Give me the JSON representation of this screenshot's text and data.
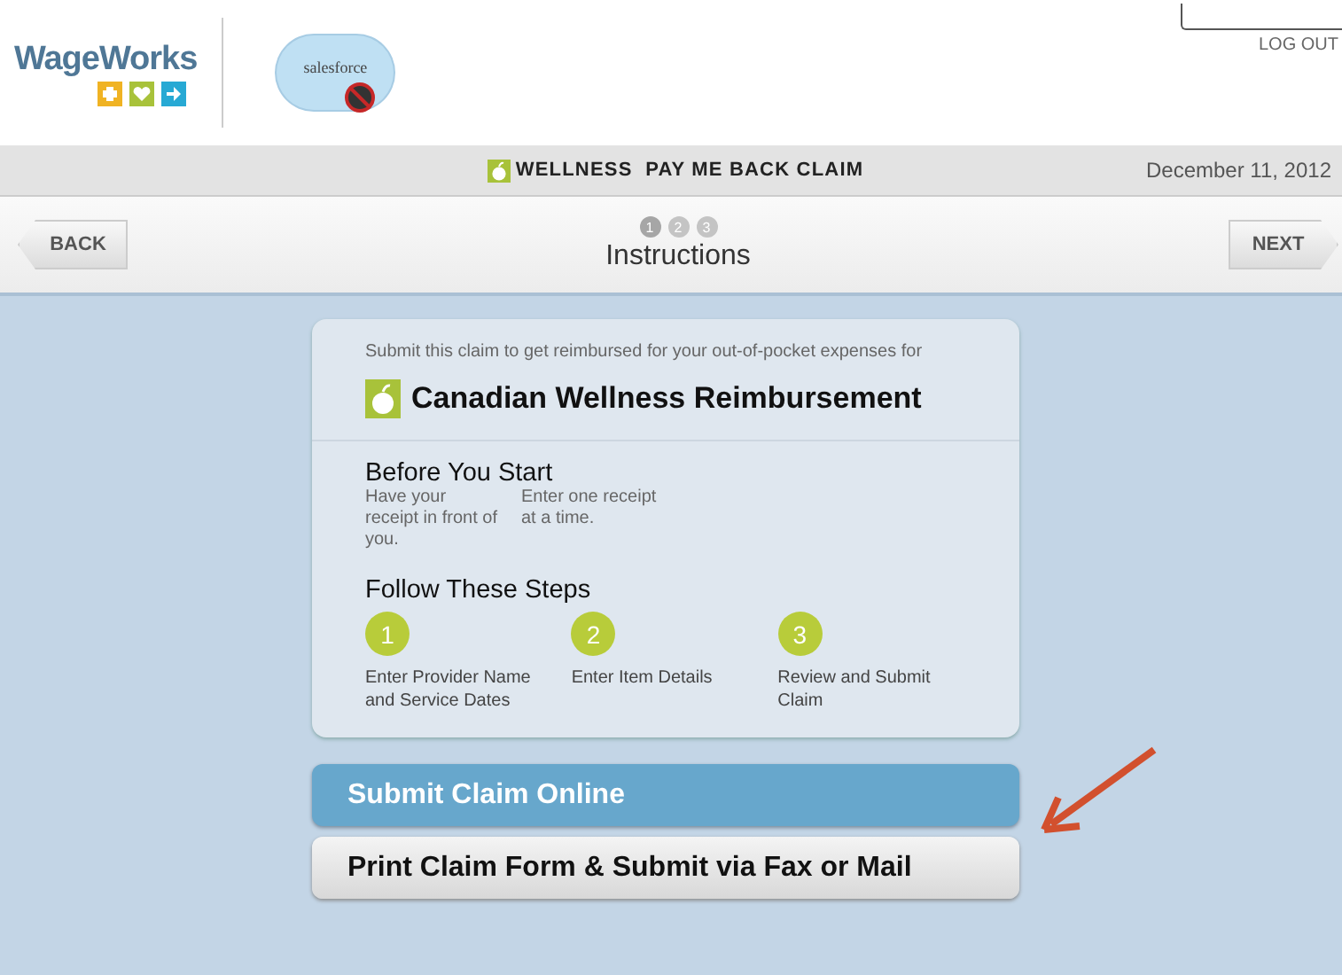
{
  "header": {
    "logo_text": "WageWorks",
    "partner_logo_text": "salesforce",
    "logout": "LOG OUT"
  },
  "title_bar": {
    "title": "WELLNESS  PAY ME BACK CLAIM",
    "date": "December 11, 2012"
  },
  "nav": {
    "back": "BACK",
    "next": "NEXT",
    "step_dots": [
      {
        "label": "1",
        "selected": true
      },
      {
        "label": "2",
        "selected": false
      },
      {
        "label": "3",
        "selected": false
      }
    ],
    "page_title": "Instructions"
  },
  "card": {
    "intro": "Submit this claim to get reimbursed for your out-of-pocket expenses for",
    "plan": "Canadian Wellness Reimbursement",
    "before_heading": "Before You Start",
    "before_items": [
      "Have your receipt in front of you.",
      "Enter one receipt at a time."
    ],
    "steps_heading": "Follow These Steps",
    "steps": [
      {
        "number": "1",
        "text": "Enter Provider Name and Service Dates"
      },
      {
        "number": "2",
        "text": "Enter Item Details"
      },
      {
        "number": "3",
        "text": "Review and Submit Claim"
      }
    ]
  },
  "actions": [
    {
      "label": "Submit Claim Online",
      "kind": "primary"
    },
    {
      "label": "Print Claim Form & Submit via Fax or Mail",
      "kind": "secondary"
    }
  ]
}
